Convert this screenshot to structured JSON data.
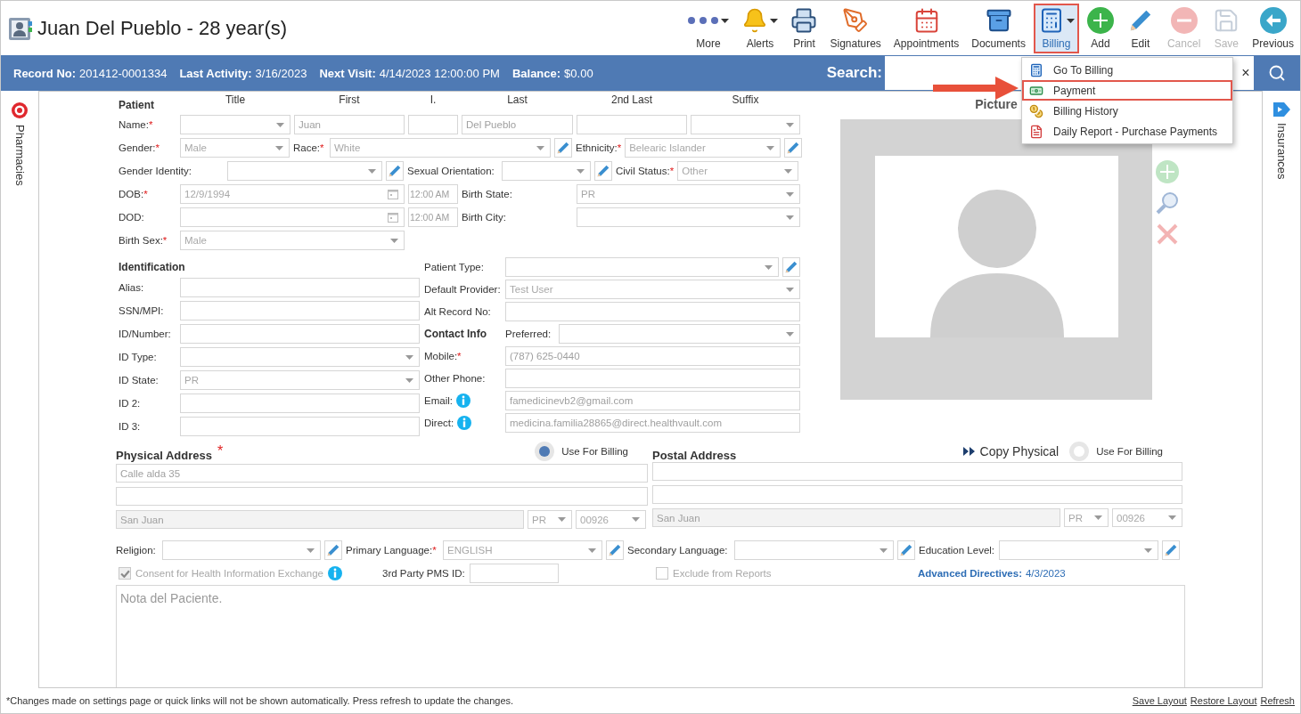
{
  "header": {
    "title": "Juan Del Pueblo - 28 year(s)"
  },
  "toolbar": [
    {
      "kind": "more",
      "label": "More",
      "caret": true,
      "selected": false,
      "disabled": false
    },
    {
      "kind": "alerts",
      "label": "Alerts",
      "caret": true,
      "selected": false,
      "disabled": false
    },
    {
      "kind": "print",
      "label": "Print",
      "caret": false,
      "selected": false,
      "disabled": false
    },
    {
      "kind": "signatures",
      "label": "Signatures",
      "caret": false,
      "selected": false,
      "disabled": false
    },
    {
      "kind": "appointments",
      "label": "Appointments",
      "caret": false,
      "selected": false,
      "disabled": false
    },
    {
      "kind": "documents",
      "label": "Documents",
      "caret": false,
      "selected": false,
      "disabled": false
    },
    {
      "kind": "billing",
      "label": "Billing",
      "caret": true,
      "selected": true,
      "disabled": false
    },
    {
      "kind": "add",
      "label": "Add",
      "caret": false,
      "selected": false,
      "disabled": false
    },
    {
      "kind": "edit",
      "label": "Edit",
      "caret": false,
      "selected": false,
      "disabled": false
    },
    {
      "kind": "cancel",
      "label": "Cancel",
      "caret": false,
      "selected": false,
      "disabled": true
    },
    {
      "kind": "save",
      "label": "Save",
      "caret": false,
      "selected": false,
      "disabled": true
    },
    {
      "kind": "previous",
      "label": "Previous",
      "caret": false,
      "selected": false,
      "disabled": false
    }
  ],
  "info_bar": {
    "items": [
      {
        "label": "Record No:",
        "value": "201412-0001334"
      },
      {
        "label": "Last Activity:",
        "value": "3/16/2023"
      },
      {
        "label": "Next Visit:",
        "value": "4/14/2023 12:00:00 PM"
      },
      {
        "label": "Balance:",
        "value": "$0.00"
      }
    ],
    "search_label": "Search:",
    "clear": "×"
  },
  "billing_menu": [
    {
      "kind": "billing",
      "label": "Go To Billing",
      "selected": false
    },
    {
      "kind": "payment",
      "label": "Payment",
      "selected": true
    },
    {
      "kind": "history",
      "label": "Billing History",
      "selected": false
    },
    {
      "kind": "pdf",
      "label": "Daily Report - Purchase Payments",
      "selected": false
    }
  ],
  "left_tab": {
    "label": "Pharmacies"
  },
  "right_tab": {
    "label": "Insurances"
  },
  "patient": {
    "heading": "Patient",
    "columns": [
      "Title",
      "First",
      "I.",
      "Last",
      "2nd Last",
      "Suffix"
    ],
    "name": {
      "label": "Name:",
      "mark": "*",
      "first": "Juan",
      "last": "Del Pueblo"
    },
    "gender": {
      "label": "Gender:",
      "mark": "*",
      "value": "Male"
    },
    "race": {
      "label": "Race:",
      "mark": "*",
      "value": "White"
    },
    "ethnicity": {
      "label": "Ethnicity:",
      "mark": "*",
      "value": "Belearic Islander"
    },
    "gender_identity": {
      "label": "Gender Identity:"
    },
    "sexual_orientation": {
      "label": "Sexual Orientation:"
    },
    "civil_status": {
      "label": "Civil Status:",
      "mark": "*",
      "value": "Other"
    },
    "dob": {
      "label": "DOB:",
      "mark": "*",
      "value": "12/9/1994",
      "time": "12:00 AM"
    },
    "birth_state": {
      "label": "Birth State:",
      "value": "PR"
    },
    "dod": {
      "label": "DOD:",
      "time": "12:00 AM"
    },
    "birth_city": {
      "label": "Birth City:"
    },
    "birth_sex": {
      "label": "Birth Sex:",
      "mark": "*",
      "value": "Male"
    }
  },
  "identification": {
    "heading": "Identification",
    "fields": [
      {
        "label": "Alias:",
        "kind": "text"
      },
      {
        "label": "SSN/MPI:",
        "kind": "text"
      },
      {
        "label": "ID/Number:",
        "kind": "text"
      },
      {
        "label": "ID Type:",
        "kind": "select"
      },
      {
        "label": "ID State:",
        "kind": "select",
        "value": "PR"
      },
      {
        "label": "ID 2:",
        "kind": "text"
      },
      {
        "label": "ID 3:",
        "kind": "text"
      }
    ]
  },
  "details": {
    "patient_type": {
      "label": "Patient Type:"
    },
    "default_provider": {
      "label": "Default Provider:",
      "value": "Test User"
    },
    "alt_record": {
      "label": "Alt Record No:"
    }
  },
  "contact": {
    "heading": "Contact Info",
    "preferred": {
      "label": "Preferred:"
    },
    "fields": [
      {
        "label": "Mobile:",
        "mark": "*",
        "value": "(787) 625-0440",
        "info": false
      },
      {
        "label": "Other Phone:",
        "info": false
      },
      {
        "label": "Email:",
        "info": true,
        "value": "famedicinevb2@gmail.com"
      },
      {
        "label": "Direct:",
        "info": true,
        "value": "medicina.familia28865@direct.healthvault.com"
      }
    ]
  },
  "picture": {
    "label": "Picture"
  },
  "physical_address": {
    "heading": "Physical Address",
    "mark": "*",
    "use_for_billing": {
      "label": "Use For Billing",
      "selected": true
    },
    "line1": "Calle alda 35",
    "city": "San Juan",
    "state": "PR",
    "zip": "00926"
  },
  "postal_address": {
    "heading": "Postal Address",
    "copy": "Copy Physical",
    "use_for_billing": {
      "label": "Use For Billing",
      "selected": false
    },
    "city": "San Juan",
    "state": "PR",
    "zip": "00926"
  },
  "demographics": [
    {
      "label": "Religion:"
    },
    {
      "label": "Primary Language:",
      "mark": "*",
      "value": "ENGLISH"
    },
    {
      "label": "Secondary Language:"
    },
    {
      "label": "Education Level:"
    }
  ],
  "consent": {
    "label": "Consent for Health Information Exchange",
    "checked": true,
    "disabled": true
  },
  "third_party": {
    "label": "3rd Party PMS ID:"
  },
  "exclude": {
    "label": "Exclude from Reports",
    "checked": false,
    "disabled": true
  },
  "advanced_directives": {
    "label": "Advanced Directives:",
    "value": "4/3/2023"
  },
  "notes": {
    "placeholder": "Nota del Paciente."
  },
  "footer": {
    "note": "*Changes made on settings page or quick links will not be shown automatically. Press refresh to update the changes.",
    "links": [
      "Save Layout",
      "Restore Layout",
      "Refresh"
    ]
  }
}
